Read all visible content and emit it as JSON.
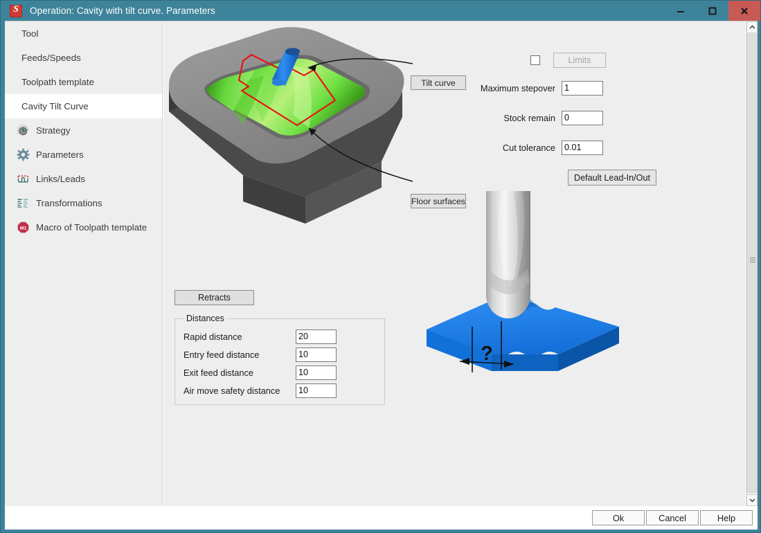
{
  "window": {
    "title": "Operation: Cavity with tilt curve. Parameters",
    "app_icon": "sprut-logo-icon",
    "controls": {
      "minimize": "minimize-icon",
      "maximize": "maximize-icon",
      "close": "close-icon"
    }
  },
  "sidebar": {
    "items": [
      {
        "label": "Tool",
        "icon": null,
        "selected": false
      },
      {
        "label": "Feeds/Speeds",
        "icon": null,
        "selected": false
      },
      {
        "label": "Toolpath template",
        "icon": null,
        "selected": false
      },
      {
        "label": "Cavity Tilt Curve",
        "icon": null,
        "selected": true
      },
      {
        "label": "Strategy",
        "icon": "dial-knob-icon",
        "selected": false
      },
      {
        "label": "Parameters",
        "icon": "gear-icon",
        "selected": false
      },
      {
        "label": "Links/Leads",
        "icon": "lead-curve-icon",
        "selected": false
      },
      {
        "label": "Transformations",
        "icon": "list-lines-icon",
        "selected": false
      },
      {
        "label": "Macro of Toolpath template",
        "icon": "macro-m1-icon",
        "selected": false
      }
    ]
  },
  "graphics": {
    "top_callouts": [
      {
        "label": "Tilt curve"
      },
      {
        "label": "Floor surfaces"
      }
    ],
    "bottom_dimension_label": "?"
  },
  "parameters": {
    "limits": {
      "checkbox_checked": false,
      "button_label": "Limits",
      "button_disabled": true
    },
    "fields": [
      {
        "label": "Maximum stepover",
        "value": "1"
      },
      {
        "label": "Stock remain",
        "value": "0"
      },
      {
        "label": "Cut tolerance",
        "value": "0.01"
      }
    ],
    "lead_in_out_button": "Default Lead-In/Out"
  },
  "retracts": {
    "button_label": "Retracts"
  },
  "distances": {
    "legend": "Distances",
    "rows": [
      {
        "label": "Rapid distance",
        "value": "20"
      },
      {
        "label": "Entry feed distance",
        "value": "10"
      },
      {
        "label": "Exit feed distance",
        "value": "10"
      },
      {
        "label": "Air move safety distance",
        "value": "10"
      }
    ]
  },
  "footer": {
    "ok": "Ok",
    "cancel": "Cancel",
    "help": "Help"
  },
  "colors": {
    "titlebar": "#3d8399",
    "close_button": "#c75a55",
    "accent_red": "#d03a33",
    "panel_bg": "#eeeeee",
    "selected_bg": "#ffffff",
    "toolpath_curve": "#e81b1b",
    "surface_green": "#55d02a",
    "tool_blue": "#1f7fe0",
    "workpiece_blue": "#0a66d0"
  }
}
